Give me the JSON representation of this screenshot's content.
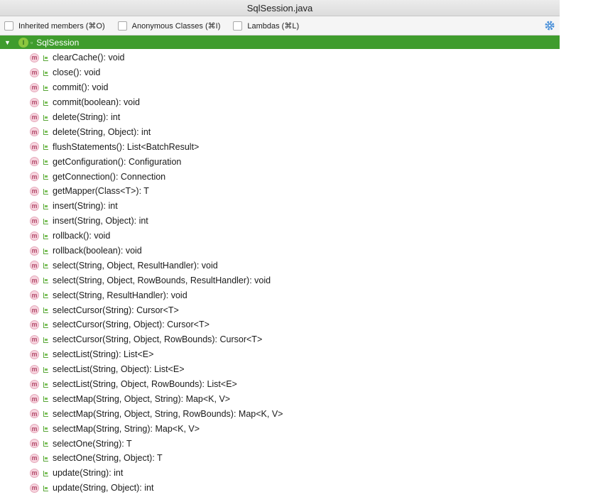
{
  "window": {
    "title": "SqlSession.java"
  },
  "toolbar": {
    "filters": [
      {
        "label": "Inherited members (⌘O)",
        "checked": false
      },
      {
        "label": "Anonymous Classes (⌘I)",
        "checked": false
      },
      {
        "label": "Lambdas (⌘L)",
        "checked": false
      }
    ],
    "settings_icon": "gear-icon",
    "accent": "#4a90d9"
  },
  "tree": {
    "root": {
      "label": "SqlSession",
      "icon": "interface-icon",
      "highlight": "#3f9c2d"
    },
    "methods": [
      "clearCache(): void",
      "close(): void",
      "commit(): void",
      "commit(boolean): void",
      "delete(String): int",
      "delete(String, Object): int",
      "flushStatements(): List<BatchResult>",
      "getConfiguration(): Configuration",
      "getConnection(): Connection",
      "getMapper(Class<T>): T",
      "insert(String): int",
      "insert(String, Object): int",
      "rollback(): void",
      "rollback(boolean): void",
      "select(String, Object, ResultHandler): void",
      "select(String, Object, RowBounds, ResultHandler): void",
      "select(String, ResultHandler): void",
      "selectCursor(String): Cursor<T>",
      "selectCursor(String, Object): Cursor<T>",
      "selectCursor(String, Object, RowBounds): Cursor<T>",
      "selectList(String): List<E>",
      "selectList(String, Object): List<E>",
      "selectList(String, Object, RowBounds): List<E>",
      "selectMap(String, Object, String): Map<K, V>",
      "selectMap(String, Object, String, RowBounds): Map<K, V>",
      "selectMap(String, String): Map<K, V>",
      "selectOne(String): T",
      "selectOne(String, Object): T",
      "update(String): int",
      "update(String, Object): int"
    ],
    "method_icon_letter": "m"
  }
}
